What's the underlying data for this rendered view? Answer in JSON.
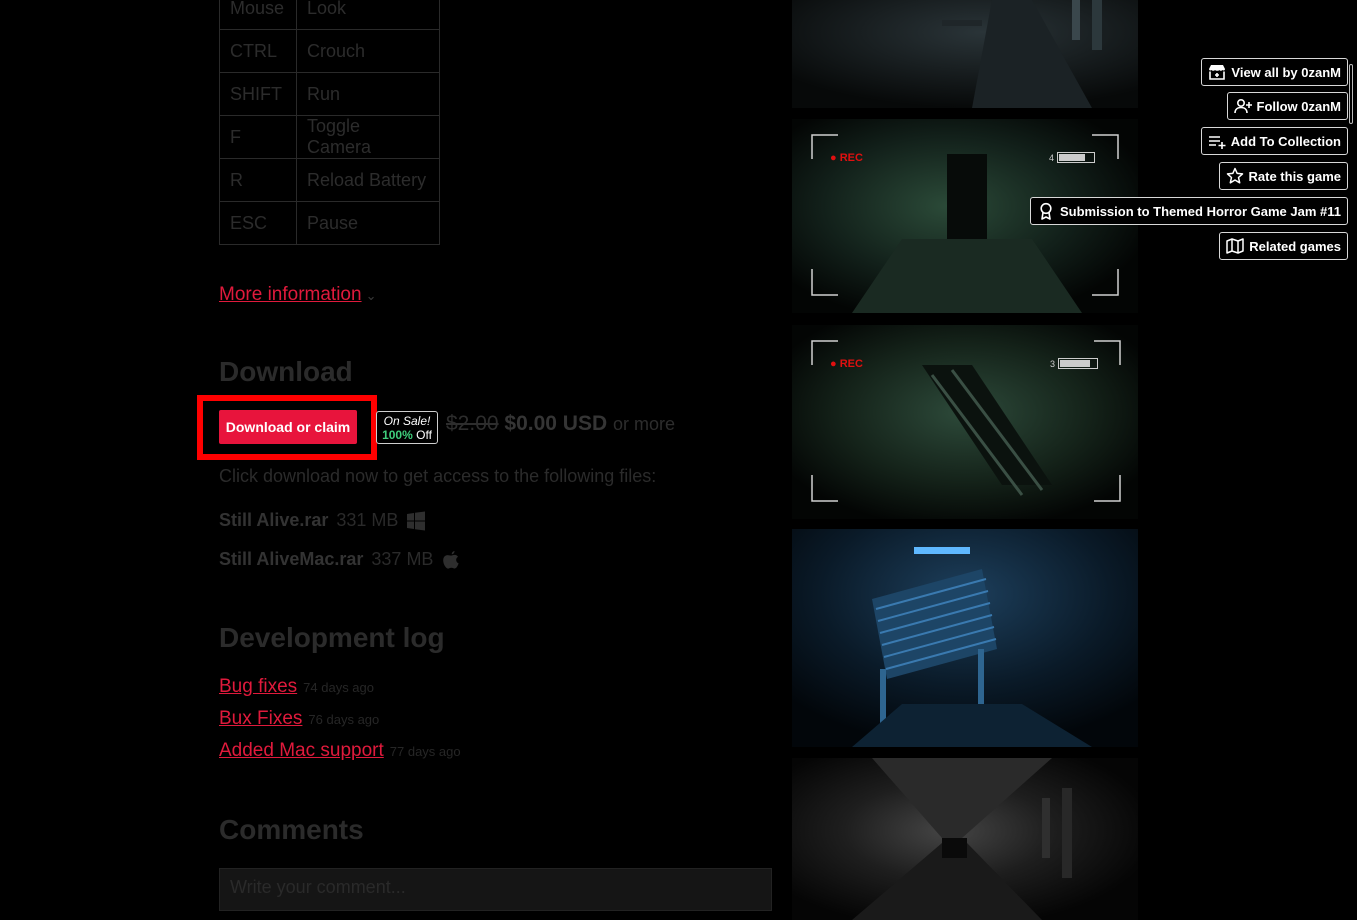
{
  "controls": [
    {
      "key": "Mouse",
      "action": "Look"
    },
    {
      "key": "CTRL",
      "action": "Crouch"
    },
    {
      "key": "SHIFT",
      "action": "Run"
    },
    {
      "key": "F",
      "action": "Toggle Camera"
    },
    {
      "key": "R",
      "action": "Reload Battery"
    },
    {
      "key": "ESC",
      "action": "Pause"
    }
  ],
  "more_information": "More information",
  "download": {
    "heading": "Download",
    "button_label": "Download or claim",
    "sale_badge": {
      "line1": "On Sale!",
      "percent": "100%",
      "off": "Off"
    },
    "old_price": "$2.00",
    "new_price": "$0.00 USD",
    "or_more": "or more",
    "click_text": "Click download now to get access to the following files:",
    "files": [
      {
        "name": "Still Alive.rar",
        "size": "331 MB",
        "platform": "windows-icon"
      },
      {
        "name": "Still AliveMac.rar",
        "size": "337 MB",
        "platform": "apple-icon"
      }
    ]
  },
  "devlog": {
    "heading": "Development log",
    "items": [
      {
        "title": "Bug fixes",
        "ago": "74 days ago"
      },
      {
        "title": "Bux Fixes",
        "ago": "76 days ago"
      },
      {
        "title": "Added Mac support",
        "ago": "77 days ago"
      }
    ]
  },
  "comments": {
    "heading": "Comments",
    "placeholder": "Write your comment..."
  },
  "screenshots": [
    {
      "rec_label": "REC",
      "battery_level": "4"
    },
    {
      "rec_label": "REC",
      "battery_level": "3"
    }
  ],
  "actions": [
    {
      "label": "View all by 0zanM",
      "icon": "itchio-icon"
    },
    {
      "label": "Follow 0zanM",
      "icon": "add-user-icon"
    },
    {
      "label": "Add To Collection",
      "icon": "add-list-icon"
    },
    {
      "label": "Rate this game",
      "icon": "star-icon"
    },
    {
      "label": "Submission to Themed Horror Game Jam #11",
      "icon": "award-icon"
    },
    {
      "label": "Related games",
      "icon": "map-icon"
    }
  ],
  "colors": {
    "accent": "#e8143c",
    "link": "#e01a3c",
    "sale_green": "#3fcf7c",
    "highlight": "#ff0000"
  }
}
